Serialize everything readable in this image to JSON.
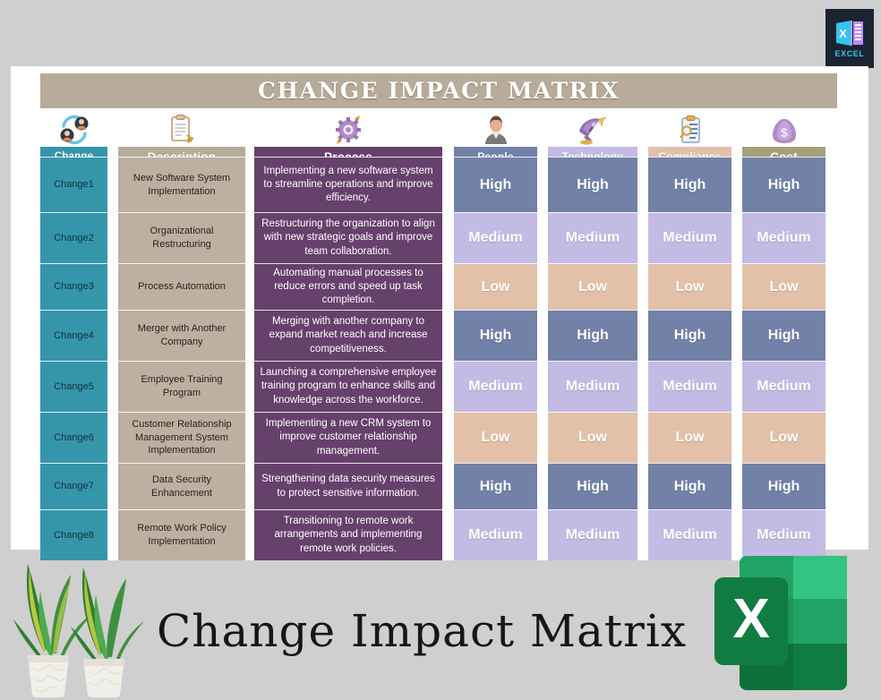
{
  "badge": {
    "label": "EXCEL",
    "icon": "excel-icon",
    "bg": "#1b2430",
    "text_color": "#34c6f4"
  },
  "banner": {
    "title": "CHANGE IMPACT MATRIX",
    "bg": "#b9ab99"
  },
  "footer": {
    "title": "Change Impact Matrix",
    "logo": "excel-logo",
    "decor": "snake-plants"
  },
  "columns": [
    {
      "key": "change",
      "label": "Change",
      "icon": "change-people-icon",
      "header_bg": "#3596ab",
      "cell_bg": "#3596ab"
    },
    {
      "key": "description",
      "label": "Description",
      "icon": "clipboard-icon",
      "header_bg": "#b9ab99",
      "cell_bg": "#bdb0a0"
    },
    {
      "key": "process",
      "label": "Process",
      "icon": "gear-process-icon",
      "header_bg": "#66416b",
      "cell_bg": "#66416b"
    },
    {
      "key": "people",
      "label": "People",
      "icon": "person-icon",
      "header_bg": "#7281a8"
    },
    {
      "key": "technology",
      "label": "Technology",
      "icon": "satellite-dish-icon",
      "header_bg": "#c3bbe4"
    },
    {
      "key": "compliance",
      "label": "Compliance",
      "icon": "clipboard-search-icon",
      "header_bg": "#e2c1a8"
    },
    {
      "key": "cost",
      "label": "Cost",
      "icon": "money-bag-icon",
      "header_bg": "#a7a179"
    }
  ],
  "levels": {
    "high": {
      "label": "High",
      "color": "#7281a8"
    },
    "medium": {
      "label": "Medium",
      "color": "#c3bbe4"
    },
    "low": {
      "label": "Low",
      "color": "#e2c1a8"
    }
  },
  "rows": [
    {
      "change": "Change1",
      "description": "New Software System Implementation",
      "process": "Implementing a new software system to streamline operations and improve efficiency.",
      "people": "High",
      "technology": "High",
      "compliance": "High",
      "cost": "High"
    },
    {
      "change": "Change2",
      "description": "Organizational  Restructuring",
      "process": "Restructuring the organization to align with new strategic goals and improve team collaboration.",
      "people": "Medium",
      "technology": "Medium",
      "compliance": "Medium",
      "cost": "Medium"
    },
    {
      "change": "Change3",
      "description": "Process Automation",
      "process": "Automating manual processes to reduce errors and speed up task completion.",
      "people": "Low",
      "technology": "Low",
      "compliance": "Low",
      "cost": "Low"
    },
    {
      "change": "Change4",
      "description": "Merger with Another Company",
      "process": "Merging with another company to expand market reach and increase competitiveness.",
      "people": "High",
      "technology": "High",
      "compliance": "High",
      "cost": "High"
    },
    {
      "change": "Change5",
      "description": "Employee Training Program",
      "process": "Launching a comprehensive employee training program to enhance skills and knowledge across the workforce.",
      "people": "Medium",
      "technology": "Medium",
      "compliance": "Medium",
      "cost": "Medium"
    },
    {
      "change": "Change6",
      "description": "Customer Relationship Management System Implementation",
      "process": "Implementing a new CRM system to improve customer relationship management.",
      "people": "Low",
      "technology": "Low",
      "compliance": "Low",
      "cost": "Low"
    },
    {
      "change": "Change7",
      "description": "Data Security Enhancement",
      "process": "Strengthening data security measures to protect sensitive information.",
      "people": "High",
      "technology": "High",
      "compliance": "High",
      "cost": "High"
    },
    {
      "change": "Change8",
      "description": "Remote Work Policy Implementation",
      "process": "Transitioning to remote work arrangements and implementing remote work policies.",
      "people": "Medium",
      "technology": "Medium",
      "compliance": "Medium",
      "cost": "Medium"
    }
  ]
}
